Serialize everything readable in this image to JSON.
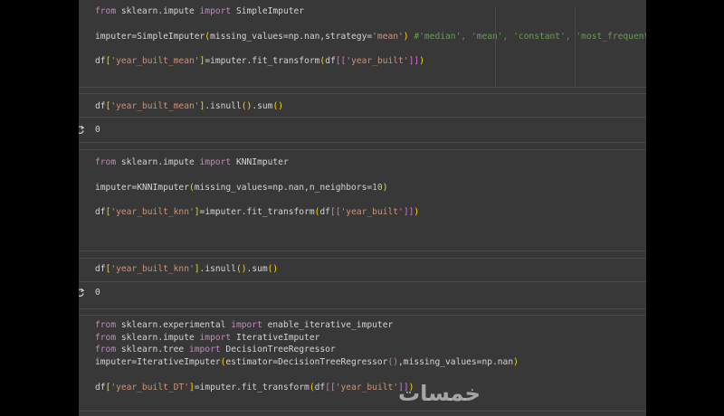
{
  "cells": [
    {
      "lines": [
        [
          [
            "kw",
            "from"
          ],
          [
            "t",
            " sklearn.impute "
          ],
          [
            "kw",
            "import"
          ],
          [
            "t",
            " SimpleImputer"
          ]
        ],
        [],
        [
          [
            "t",
            "imputer=SimpleImputer"
          ],
          [
            "p1",
            "("
          ],
          [
            "t",
            "missing_values=np.nan,strategy="
          ],
          [
            "str",
            "'mean'"
          ],
          [
            "p1",
            ")"
          ],
          [
            "cm",
            " #'median', 'mean', 'constant', 'most_frequent'"
          ]
        ],
        [],
        [
          [
            "t",
            "df"
          ],
          [
            "p1",
            "["
          ],
          [
            "str",
            "'year_built_mean'"
          ],
          [
            "p1",
            "]"
          ],
          [
            "t",
            "=imputer.fit_transform"
          ],
          [
            "p1",
            "("
          ],
          [
            "t",
            "df"
          ],
          [
            "p2",
            "[["
          ],
          [
            "str",
            "'year_built'"
          ],
          [
            "p2",
            "]]"
          ],
          [
            "p1",
            ")"
          ]
        ]
      ]
    },
    {
      "lines": [
        [
          [
            "t",
            "df"
          ],
          [
            "p1",
            "["
          ],
          [
            "str",
            "'year_built_mean'"
          ],
          [
            "p1",
            "]"
          ],
          [
            "t",
            ".isnull"
          ],
          [
            "p1",
            "()"
          ],
          [
            "t",
            ".sum"
          ],
          [
            "p1",
            "()"
          ]
        ]
      ],
      "output": "0"
    },
    {
      "lines": [
        [
          [
            "kw",
            "from"
          ],
          [
            "t",
            " sklearn.impute "
          ],
          [
            "kw",
            "import"
          ],
          [
            "t",
            " KNNImputer"
          ]
        ],
        [],
        [
          [
            "t",
            "imputer=KNNImputer"
          ],
          [
            "p1",
            "("
          ],
          [
            "t",
            "missing_values=np.nan,n_neighbors="
          ],
          [
            "num",
            "10"
          ],
          [
            "p1",
            ")"
          ]
        ],
        [],
        [
          [
            "t",
            "df"
          ],
          [
            "p1",
            "["
          ],
          [
            "str",
            "'year_built_knn'"
          ],
          [
            "p1",
            "]"
          ],
          [
            "t",
            "=imputer.fit_transform"
          ],
          [
            "p1",
            "("
          ],
          [
            "t",
            "df"
          ],
          [
            "p2",
            "[["
          ],
          [
            "str",
            "'year_built'"
          ],
          [
            "p2",
            "]]"
          ],
          [
            "p1",
            ")"
          ]
        ]
      ]
    },
    {
      "lines": [
        [
          [
            "t",
            "df"
          ],
          [
            "p1",
            "["
          ],
          [
            "str",
            "'year_built_knn'"
          ],
          [
            "p1",
            "]"
          ],
          [
            "t",
            ".isnull"
          ],
          [
            "p1",
            "()"
          ],
          [
            "t",
            ".sum"
          ],
          [
            "p1",
            "()"
          ]
        ]
      ],
      "output": "0"
    },
    {
      "lines": [
        [
          [
            "kw",
            "from"
          ],
          [
            "t",
            " sklearn.experimental "
          ],
          [
            "kw",
            "import"
          ],
          [
            "t",
            " enable_iterative_imputer"
          ]
        ],
        [
          [
            "kw",
            "from"
          ],
          [
            "t",
            " sklearn.impute "
          ],
          [
            "kw",
            "import"
          ],
          [
            "t",
            " IterativeImputer"
          ]
        ],
        [
          [
            "kw",
            "from"
          ],
          [
            "t",
            " sklearn.tree "
          ],
          [
            "kw",
            "import"
          ],
          [
            "t",
            " DecisionTreeRegressor"
          ]
        ],
        [
          [
            "t",
            "imputer=IterativeImputer"
          ],
          [
            "p1",
            "("
          ],
          [
            "t",
            "estimator=DecisionTreeRegressor"
          ],
          [
            "p2",
            "()"
          ],
          [
            "t",
            ",missing_values=np.nan"
          ],
          [
            "p1",
            ")"
          ]
        ],
        [],
        [
          [
            "t",
            "df"
          ],
          [
            "p1",
            "["
          ],
          [
            "str",
            "'year_built_DT'"
          ],
          [
            "p1",
            "]"
          ],
          [
            "t",
            "=imputer.fit_transform"
          ],
          [
            "p1",
            "("
          ],
          [
            "t",
            "df"
          ],
          [
            "p2",
            "[["
          ],
          [
            "str",
            "'year_built'"
          ],
          [
            "p2",
            "]]"
          ],
          [
            "p1",
            ")"
          ]
        ]
      ]
    }
  ],
  "watermark": "خمسات",
  "colors": {
    "background": "#383838",
    "keyword": "#c586c0",
    "string": "#ce9178",
    "number": "#b5cea8",
    "comment": "#6a9955",
    "bracket_level1": "#ffd700",
    "bracket_level2": "#da70d6"
  },
  "icons": {
    "output_icon": "refresh-arrow-icon"
  }
}
